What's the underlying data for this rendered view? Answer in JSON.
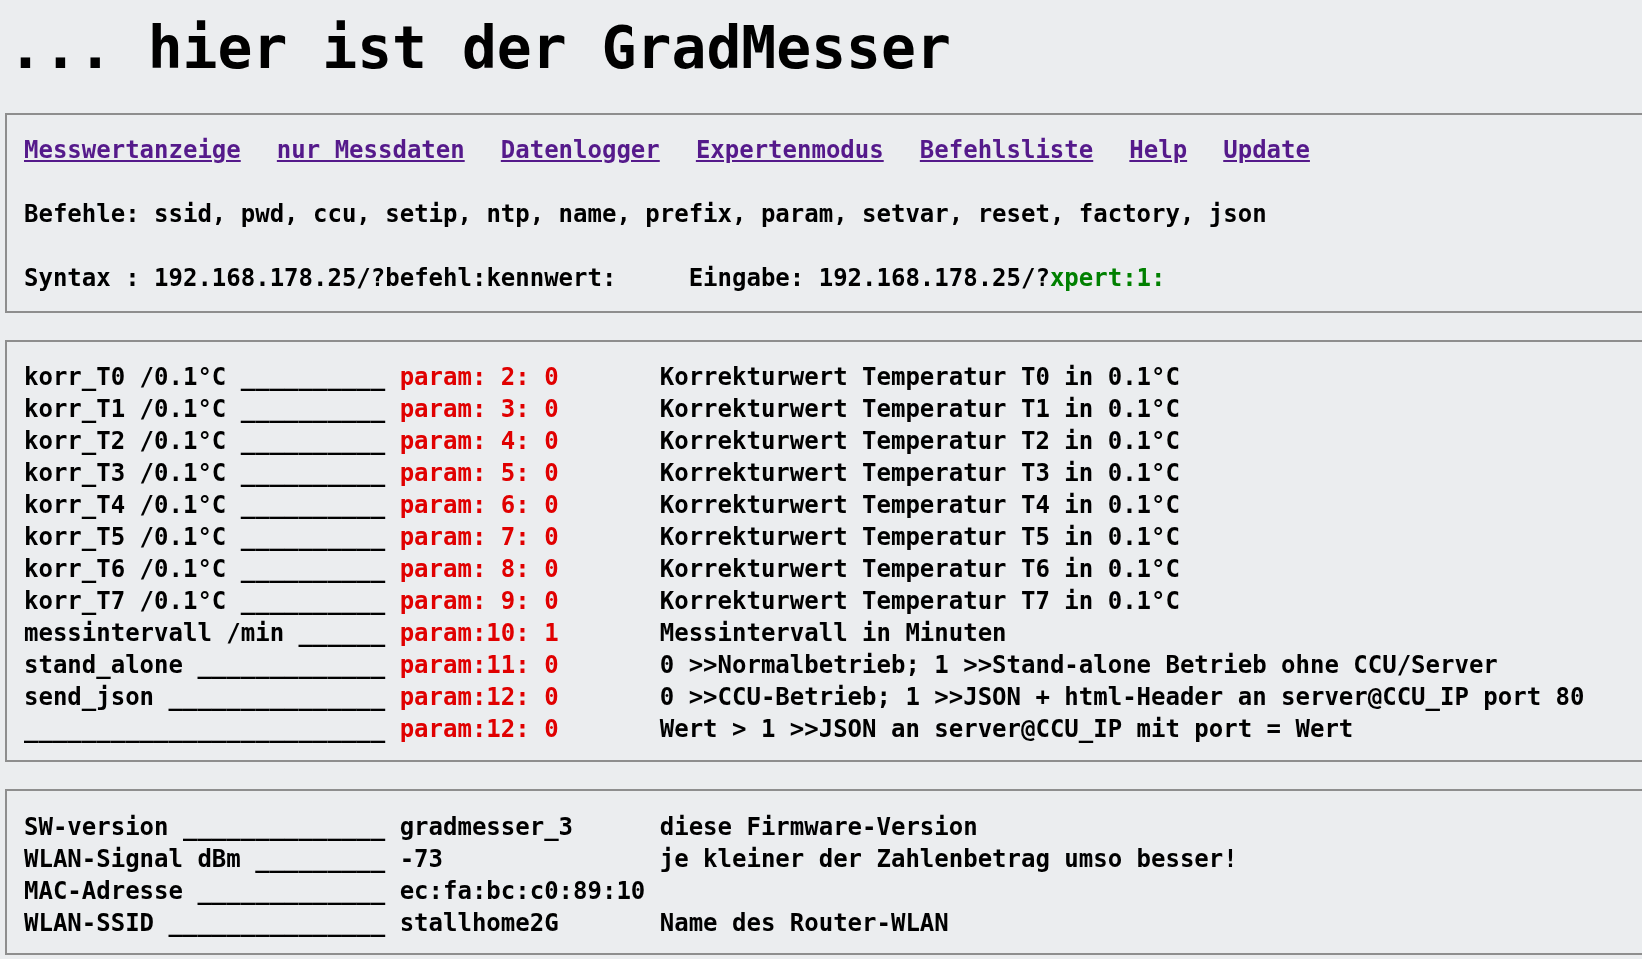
{
  "title": "... hier ist der GradMesser",
  "nav_links": [
    "Messwertanzeige",
    "nur Messdaten",
    "Datenlogger",
    "Expertenmodus",
    "Befehlsliste",
    "Help",
    "Update"
  ],
  "commands_line": "Befehle: ssid, pwd, ccu, setip, ntp, name, prefix, param, setvar, reset, factory, json",
  "syntax": {
    "text": "Syntax : 192.168.178.25/?befehl:kennwert:",
    "input_prefix": "Eingabe: 192.168.178.25/?",
    "input_highlight": "xpert:1:"
  },
  "params": [
    {
      "label": "korr_T0 /0.1°C __________",
      "param": "param: 2: 0",
      "description": "Korrekturwert Temperatur T0 in 0.1°C"
    },
    {
      "label": "korr_T1 /0.1°C __________",
      "param": "param: 3: 0",
      "description": "Korrekturwert Temperatur T1 in 0.1°C"
    },
    {
      "label": "korr_T2 /0.1°C __________",
      "param": "param: 4: 0",
      "description": "Korrekturwert Temperatur T2 in 0.1°C"
    },
    {
      "label": "korr_T3 /0.1°C __________",
      "param": "param: 5: 0",
      "description": "Korrekturwert Temperatur T3 in 0.1°C"
    },
    {
      "label": "korr_T4 /0.1°C __________",
      "param": "param: 6: 0",
      "description": "Korrekturwert Temperatur T4 in 0.1°C"
    },
    {
      "label": "korr_T5 /0.1°C __________",
      "param": "param: 7: 0",
      "description": "Korrekturwert Temperatur T5 in 0.1°C"
    },
    {
      "label": "korr_T6 /0.1°C __________",
      "param": "param: 8: 0",
      "description": "Korrekturwert Temperatur T6 in 0.1°C"
    },
    {
      "label": "korr_T7 /0.1°C __________",
      "param": "param: 9: 0",
      "description": "Korrekturwert Temperatur T7 in 0.1°C"
    },
    {
      "label": "messintervall /min ______",
      "param": "param:10: 1",
      "description": "Messintervall in Minuten"
    },
    {
      "label": "stand_alone _____________",
      "param": "param:11: 0",
      "description": "0 >>Normalbetrieb; 1 >>Stand-alone Betrieb ohne CCU/Server"
    },
    {
      "label": "send_json _______________",
      "param": "param:12: 0",
      "description": "0 >>CCU-Betrieb; 1 >>JSON + html-Header an server@CCU_IP port 80"
    },
    {
      "label": "_________________________",
      "param": "param:12: 0",
      "description": "Wert > 1 >>JSON an server@CCU_IP mit port = Wert"
    }
  ],
  "info": [
    {
      "label": "SW-version ______________",
      "value": "gradmesser_3",
      "description": "diese Firmware-Version"
    },
    {
      "label": "WLAN-Signal dBm _________",
      "value": "-73",
      "description": "je kleiner der Zahlenbetrag umso besser!"
    },
    {
      "label": "MAC-Adresse _____________",
      "value": "ec:fa:bc:c0:89:10"
    },
    {
      "label": "WLAN-SSID _______________",
      "value": "stallhome2G",
      "description": "Name des Router-WLAN"
    }
  ]
}
